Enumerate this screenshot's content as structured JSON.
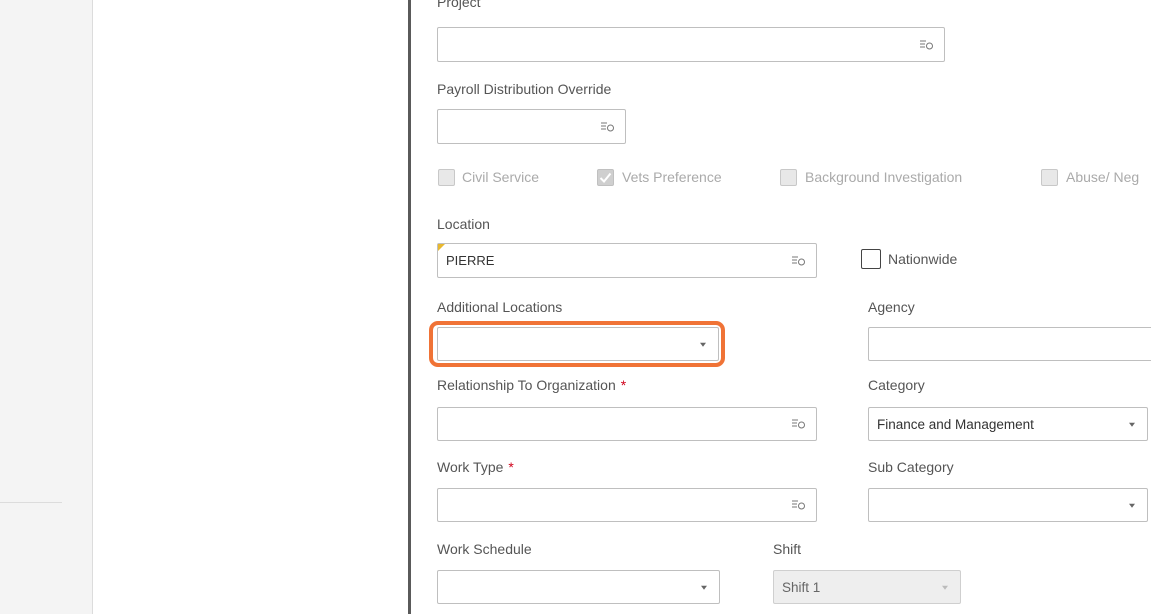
{
  "form": {
    "project_label": "Project",
    "payroll_label": "Payroll Distribution Override",
    "checkboxes": [
      {
        "label": "Civil Service",
        "checked": false
      },
      {
        "label": "Vets Preference",
        "checked": true
      },
      {
        "label": "Background Investigation",
        "checked": false
      },
      {
        "label": "Abuse/ Neg",
        "checked": false
      }
    ],
    "location_label": "Location",
    "location_value": "PIERRE",
    "nationwide_label": "Nationwide",
    "additional_locations_label": "Additional Locations",
    "agency_label": "Agency",
    "relationship_label": "Relationship To Organization",
    "required_mark": "*",
    "category_label": "Category",
    "category_value": "Finance and Management",
    "work_type_label": "Work Type",
    "sub_category_label": "Sub Category",
    "work_schedule_label": "Work Schedule",
    "shift_label": "Shift",
    "shift_value": "Shift 1"
  },
  "colors": {
    "highlight": "#f07336",
    "required": "#d0021b"
  },
  "icons": [
    "lookup-icon",
    "dropdown-caret-icon",
    "checkmark-icon"
  ]
}
